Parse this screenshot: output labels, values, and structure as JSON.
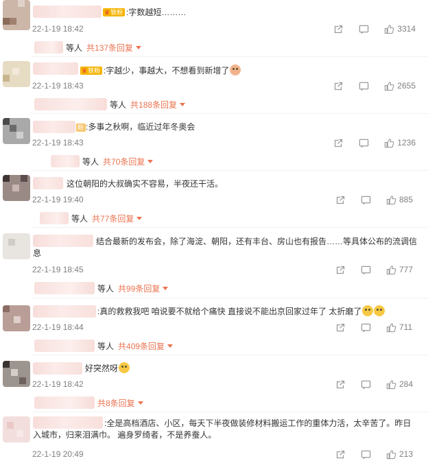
{
  "comments": [
    {
      "text": ":字数越短………",
      "badge": "铁粉",
      "time": "22-1-19 18:42",
      "likes": "3314",
      "reply_label": "等人",
      "reply_link": "共137条回复"
    },
    {
      "text": ":字越少，事越大，不想看到新增了",
      "badge": "铁粉",
      "time": "22-1-19 18:43",
      "likes": "2655",
      "reply_label": "等人",
      "reply_link": "共188条回复"
    },
    {
      "text": ":多事之秋啊，临近过年冬奥会",
      "badge": "粉",
      "time": "22-1-19 18:43",
      "likes": "1236",
      "reply_label": "等人",
      "reply_link": "共70条回复"
    },
    {
      "text": "这位朝阳的大叔确实不容易，半夜还干活。",
      "time": "22-1-19 19:40",
      "likes": "885",
      "reply_label": "等人",
      "reply_link": "共77条回复"
    },
    {
      "text": "结合最新的发布会，除了海淀、朝阳，还有丰台、房山也有报告……等具体公布的流调信息",
      "time": "22-1-19 18:45",
      "likes": "777",
      "reply_label": "等人",
      "reply_link": "共99条回复"
    },
    {
      "text": ":真的救救我吧 咱说要不就给个痛快 直接说不能出京回家过年了 太折磨了",
      "time": "22-1-19 18:44",
      "likes": "711",
      "reply_label": "等人",
      "reply_link": "共409条回复"
    },
    {
      "text": "好突然呀",
      "time": "22-1-19 18:42",
      "likes": "284",
      "reply_label": "",
      "reply_link": "共8条回复"
    },
    {
      "text": ":全是高档酒店、小区，每天下半夜做装修材料搬运工作的重体力活，太辛苦了。昨日入城市，归来泪满巾。 遍身罗绮者，不是养蚕人。",
      "time": "22-1-19 20:49",
      "likes": "213"
    }
  ],
  "icons": {
    "share": "share-icon",
    "comment": "comment-icon",
    "like": "thumbs-up-icon",
    "expand": "caret-down-icon"
  },
  "colors": {
    "reply_link": "#eb7350",
    "meta": "#808080",
    "badge": "#f5b400"
  }
}
